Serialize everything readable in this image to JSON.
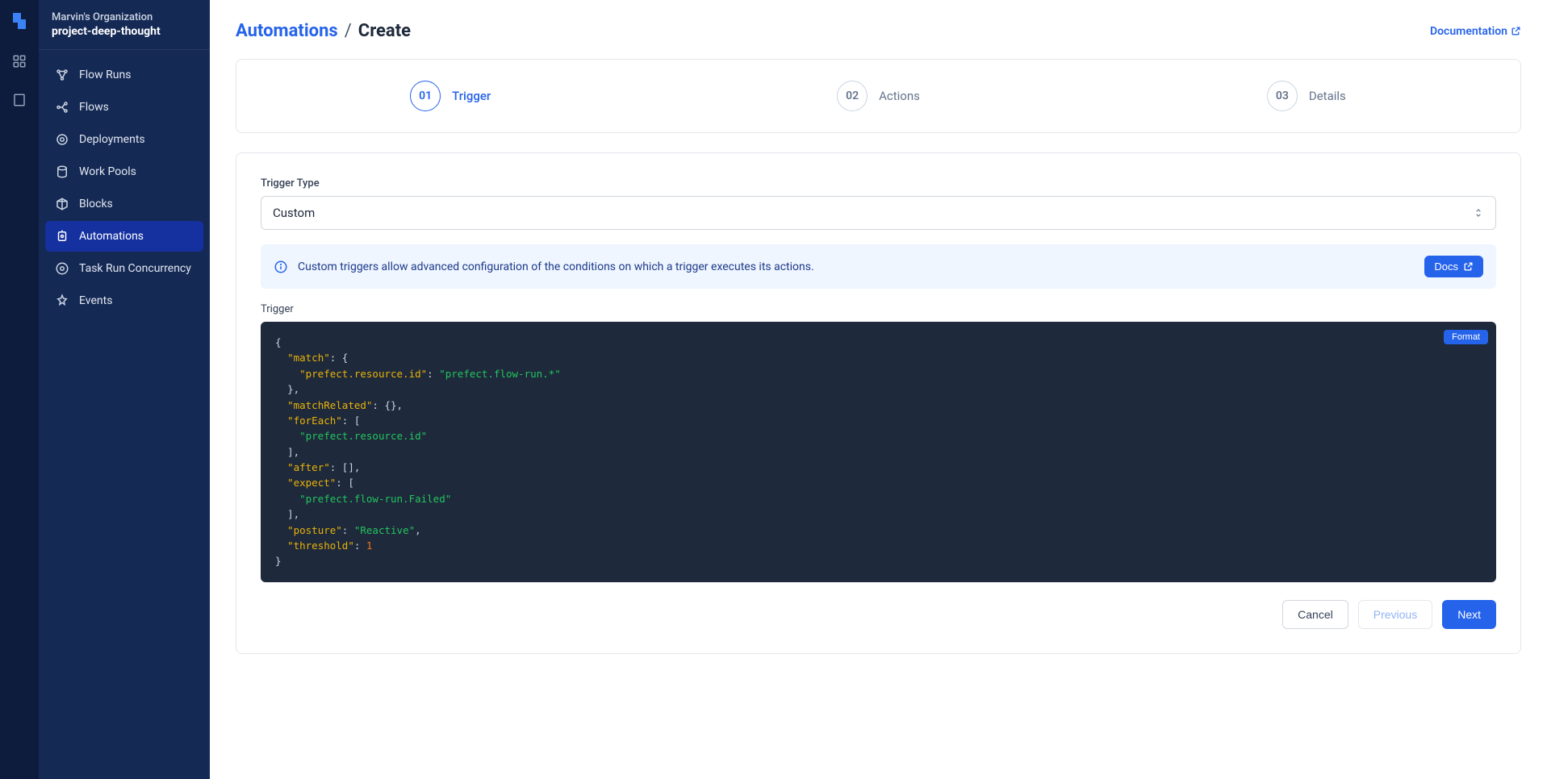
{
  "org": {
    "name": "Marvin's Organization",
    "project": "project-deep-thought"
  },
  "nav": {
    "items": [
      {
        "label": "Flow Runs",
        "icon": "flow-runs-icon"
      },
      {
        "label": "Flows",
        "icon": "flows-icon"
      },
      {
        "label": "Deployments",
        "icon": "deployments-icon"
      },
      {
        "label": "Work Pools",
        "icon": "work-pools-icon"
      },
      {
        "label": "Blocks",
        "icon": "blocks-icon"
      },
      {
        "label": "Automations",
        "icon": "automations-icon"
      },
      {
        "label": "Task Run Concurrency",
        "icon": "concurrency-icon"
      },
      {
        "label": "Events",
        "icon": "events-icon"
      }
    ],
    "active_index": 5
  },
  "breadcrumb": {
    "parent": "Automations",
    "separator": "/",
    "current": "Create"
  },
  "header": {
    "doc_link": "Documentation"
  },
  "stepper": {
    "steps": [
      {
        "num": "01",
        "label": "Trigger"
      },
      {
        "num": "02",
        "label": "Actions"
      },
      {
        "num": "03",
        "label": "Details"
      }
    ],
    "active_index": 0
  },
  "form": {
    "trigger_type_label": "Trigger Type",
    "trigger_type_value": "Custom",
    "info_text": "Custom triggers allow advanced configuration of the conditions on which a trigger executes its actions.",
    "docs_btn": "Docs",
    "trigger_label": "Trigger",
    "format_btn": "Format",
    "code": {
      "k_match": "\"match\"",
      "k_resource_id": "\"prefect.resource.id\"",
      "v_flow_run_star": "\"prefect.flow-run.*\"",
      "k_matchRelated": "\"matchRelated\"",
      "k_forEach": "\"forEach\"",
      "v_resource_id": "\"prefect.resource.id\"",
      "k_after": "\"after\"",
      "k_expect": "\"expect\"",
      "v_flow_run_failed": "\"prefect.flow-run.Failed\"",
      "k_posture": "\"posture\"",
      "v_reactive": "\"Reactive\"",
      "k_threshold": "\"threshold\"",
      "v_threshold": "1"
    }
  },
  "footer": {
    "cancel": "Cancel",
    "previous": "Previous",
    "next": "Next"
  },
  "colors": {
    "accent": "#2563eb",
    "sidebar": "#152955",
    "rail": "#0d1b3d",
    "code_bg": "#1e293b"
  }
}
